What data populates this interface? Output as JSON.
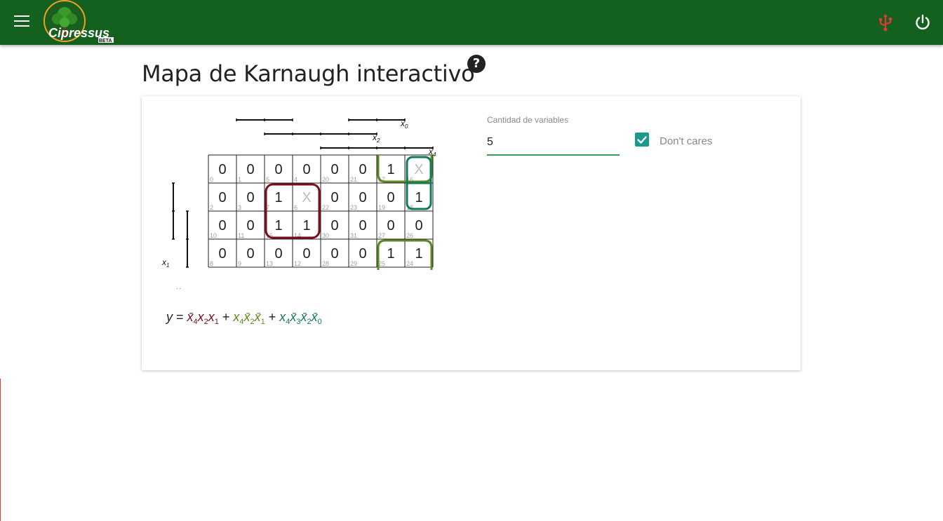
{
  "app": {
    "brand": "Cipressus",
    "brand_tag": "BETA",
    "colors": {
      "appbar": "#14601f",
      "usb": "#e53935",
      "accent": "#1a9a8f"
    }
  },
  "header": {
    "menu_icon": "hamburger-menu-icon",
    "usb_icon": "usb-icon",
    "power_icon": "power-icon"
  },
  "page": {
    "title": "Mapa de Karnaugh interactivo",
    "help_icon": "?"
  },
  "form": {
    "variables_label": "Cantidad de variables",
    "variables_value": "5",
    "dontcares_label": "Don't cares",
    "dontcares_checked": true
  },
  "kmap": {
    "cells": [
      [
        {
          "v": "0",
          "i": "0"
        },
        {
          "v": "0",
          "i": "1"
        },
        {
          "v": "0",
          "i": "5"
        },
        {
          "v": "0",
          "i": "4"
        },
        {
          "v": "0",
          "i": "20"
        },
        {
          "v": "0",
          "i": "21"
        },
        {
          "v": "1",
          "i": "17"
        },
        {
          "v": "X",
          "i": "16"
        }
      ],
      [
        {
          "v": "0",
          "i": "2"
        },
        {
          "v": "0",
          "i": "3"
        },
        {
          "v": "1",
          "i": "7"
        },
        {
          "v": "X",
          "i": "6"
        },
        {
          "v": "0",
          "i": "22"
        },
        {
          "v": "0",
          "i": "23"
        },
        {
          "v": "0",
          "i": "19"
        },
        {
          "v": "1",
          "i": "18"
        }
      ],
      [
        {
          "v": "0",
          "i": "10"
        },
        {
          "v": "0",
          "i": "11"
        },
        {
          "v": "1",
          "i": "15"
        },
        {
          "v": "1",
          "i": "14"
        },
        {
          "v": "0",
          "i": "30"
        },
        {
          "v": "0",
          "i": "31"
        },
        {
          "v": "0",
          "i": "27"
        },
        {
          "v": "0",
          "i": "26"
        }
      ],
      [
        {
          "v": "0",
          "i": "8"
        },
        {
          "v": "0",
          "i": "9"
        },
        {
          "v": "0",
          "i": "13"
        },
        {
          "v": "0",
          "i": "12"
        },
        {
          "v": "0",
          "i": "28"
        },
        {
          "v": "0",
          "i": "29"
        },
        {
          "v": "1",
          "i": "25"
        },
        {
          "v": "1",
          "i": "24"
        }
      ]
    ],
    "var_labels": {
      "x0": "x0",
      "x1": "x1",
      "x2": "x2",
      "x3": "x3",
      "x4": "x4"
    },
    "group_colors": [
      "#7a0f1a",
      "#5b8a1e",
      "#117a5a"
    ]
  },
  "equation": {
    "lhs": "y",
    "eq": "=",
    "plus": "+",
    "terms": [
      {
        "color": "#7a0f1a",
        "factors": [
          {
            "b": "x̄",
            "s": "4"
          },
          {
            "b": "x",
            "s": "2"
          },
          {
            "b": "x",
            "s": "1"
          }
        ]
      },
      {
        "color": "#5b8a1e",
        "factors": [
          {
            "b": "x",
            "s": "4"
          },
          {
            "b": "x̄",
            "s": "2"
          },
          {
            "b": "x̄",
            "s": "1"
          }
        ]
      },
      {
        "color": "#117a5a",
        "factors": [
          {
            "b": "x",
            "s": "4"
          },
          {
            "b": "x̄",
            "s": "3"
          },
          {
            "b": "x̄",
            "s": "2"
          },
          {
            "b": "x̄",
            "s": "0"
          }
        ]
      }
    ]
  }
}
